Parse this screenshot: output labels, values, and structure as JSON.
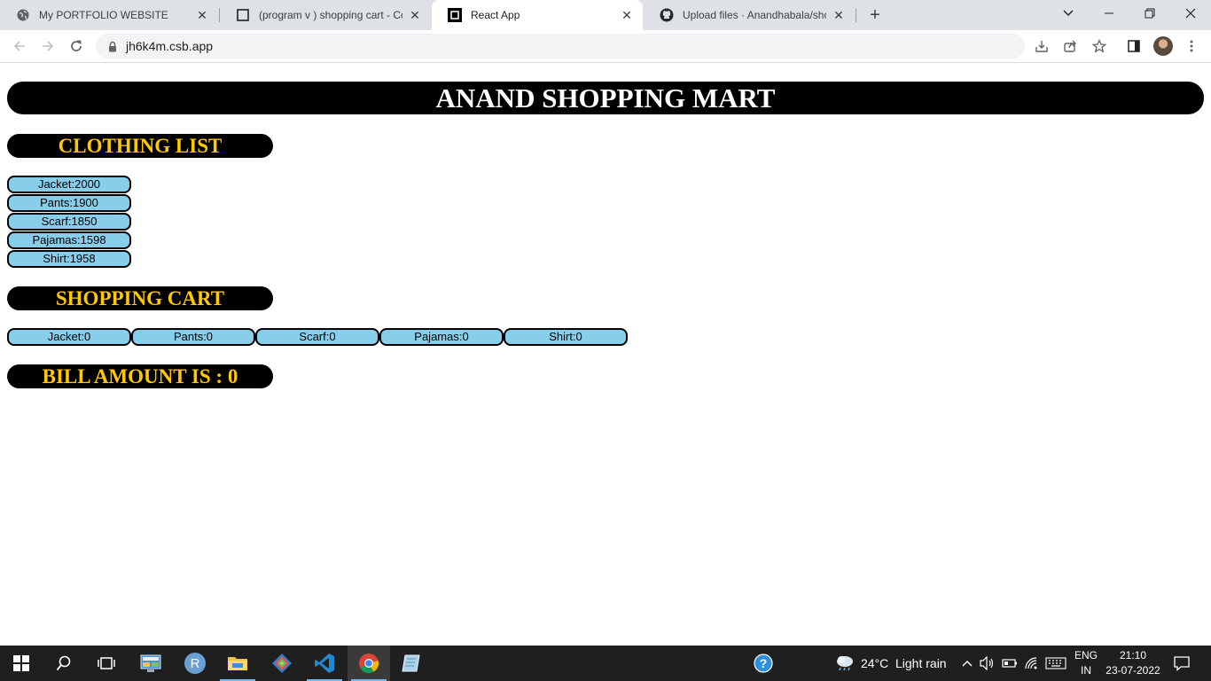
{
  "browser": {
    "tabs": [
      {
        "title": "My PORTFOLIO WEBSITE",
        "icon": "globe-icon",
        "active": false
      },
      {
        "title": "(program v ) shopping cart - Cod",
        "icon": "codesandbox-icon",
        "active": false
      },
      {
        "title": "React App",
        "icon": "react-app-icon",
        "active": true
      },
      {
        "title": "Upload files · Anandhabala/shop",
        "icon": "github-icon",
        "active": false
      }
    ],
    "address": "jh6k4m.csb.app"
  },
  "page": {
    "title": "ANAND SHOPPING MART",
    "clothing_heading": "CLOTHING LIST",
    "clothing_items": [
      "Jacket:2000",
      "Pants:1900",
      "Scarf:1850",
      "Pajamas:1598",
      "Shirt:1958"
    ],
    "cart_heading": "SHOPPING CART",
    "cart_items": [
      "Jacket:0",
      "Pants:0",
      "Scarf:0",
      "Pajamas:0",
      "Shirt:0"
    ],
    "bill_text": "BILL AMOUNT IS : 0"
  },
  "colors": {
    "heading_bg": "#000000",
    "heading_text": "#ffc800",
    "pill_bg": "#87ceeb"
  },
  "taskbar": {
    "weather_temp": "24°C",
    "weather_text": "Light rain",
    "lang_top": "ENG",
    "lang_bottom": "IN",
    "time": "21:10",
    "date": "23-07-2022"
  }
}
